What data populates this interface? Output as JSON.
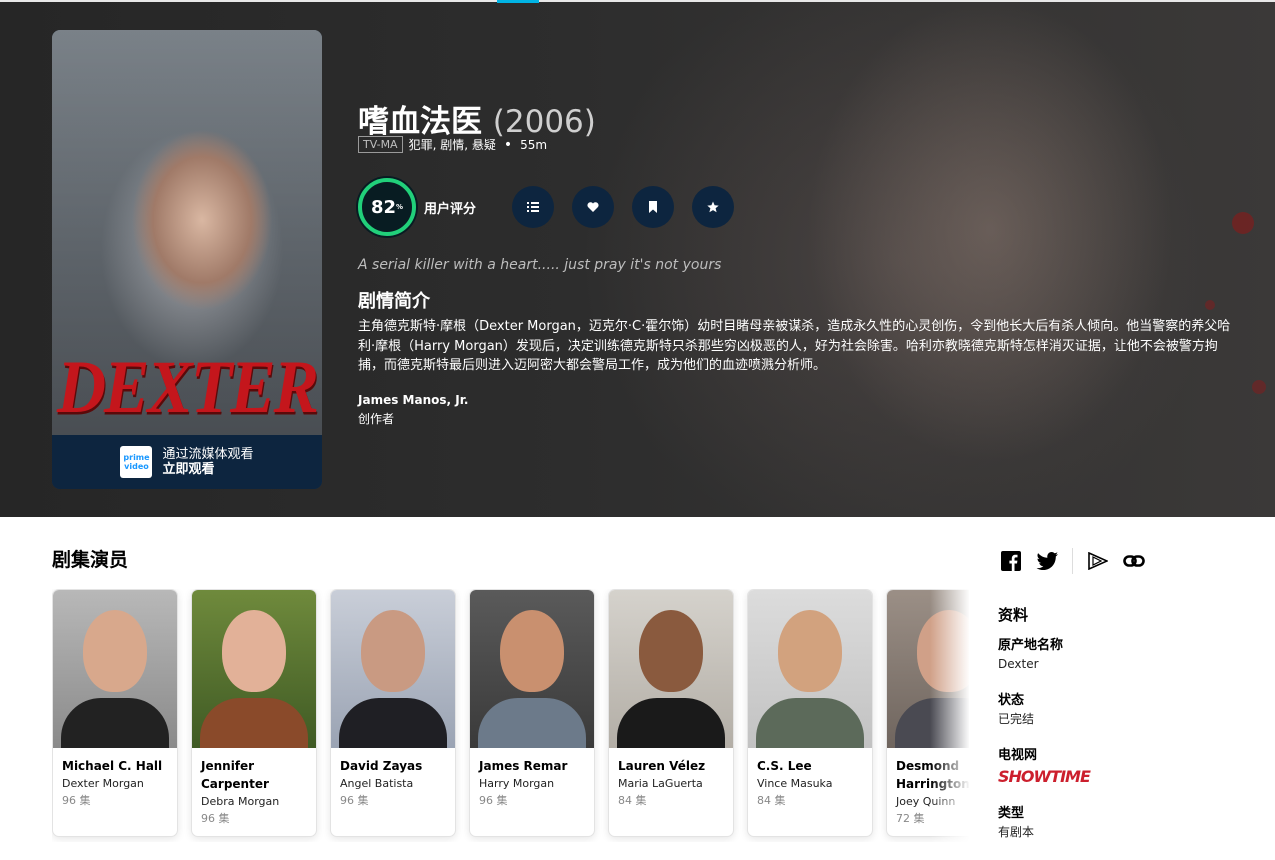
{
  "show": {
    "title": "嗜血法医",
    "year": "(2006)",
    "certification": "TV-MA",
    "genres": "犯罪, 剧情, 悬疑",
    "runtime": "55m",
    "score": "82",
    "score_unit": "%",
    "score_label": "用户评分",
    "tagline": "A serial killer with a heart..... just pray it's not yours",
    "overview_heading": "剧情简介",
    "overview": "主角德克斯特·摩根（Dexter Morgan，迈克尔·C·霍尔饰）幼时目睹母亲被谋杀，造成永久性的心灵创伤，令到他长大后有杀人倾向。他当警察的养父哈利·摩根（Harry Morgan）发现后，决定训练德克斯特只杀那些穷凶极恶的人，好为社会除害。哈利亦教晓德克斯特怎样消灭证据，让他不会被警方拘捕，而德克斯特最后则进入迈阿密大都会警局工作，成为他们的血迹喷溅分析师。",
    "creator_name": "James Manos, Jr.",
    "creator_role": "创作者"
  },
  "poster": {
    "title_art": "DEXTER",
    "logo_line1": "prime",
    "logo_line2": "video",
    "watch_line1": "通过流媒体观看",
    "watch_line2": "立即观看"
  },
  "actions": {
    "list_icon": "list-icon",
    "favorite_icon": "heart-icon",
    "watchlist_icon": "bookmark-icon",
    "rate_icon": "star-icon"
  },
  "cast": {
    "heading": "剧集演员",
    "members": [
      {
        "name": "Michael C. Hall",
        "character": "Dexter Morgan",
        "episodes": "96 集"
      },
      {
        "name": "Jennifer Carpenter",
        "character": "Debra Morgan",
        "episodes": "96 集"
      },
      {
        "name": "David Zayas",
        "character": "Angel Batista",
        "episodes": "96 集"
      },
      {
        "name": "James Remar",
        "character": "Harry Morgan",
        "episodes": "96 集"
      },
      {
        "name": "Lauren Vélez",
        "character": "Maria LaGuerta",
        "episodes": "84 集"
      },
      {
        "name": "C.S. Lee",
        "character": "Vince Masuka",
        "episodes": "84 集"
      },
      {
        "name": "Desmond Harrington",
        "character": "Joey Quinn",
        "episodes": "72 集"
      }
    ]
  },
  "sidebar": {
    "facts_heading": "资料",
    "original_name_label": "原产地名称",
    "original_name": "Dexter",
    "status_label": "状态",
    "status": "已完结",
    "network_label": "电视网",
    "network": "SHOWTIME",
    "type_label": "类型",
    "type": "有剧本"
  },
  "colors": {
    "accent": "#01b4e4",
    "score_ring": "#21d07a",
    "button_bg": "#0d253f",
    "network_red": "#cc1f2d"
  }
}
